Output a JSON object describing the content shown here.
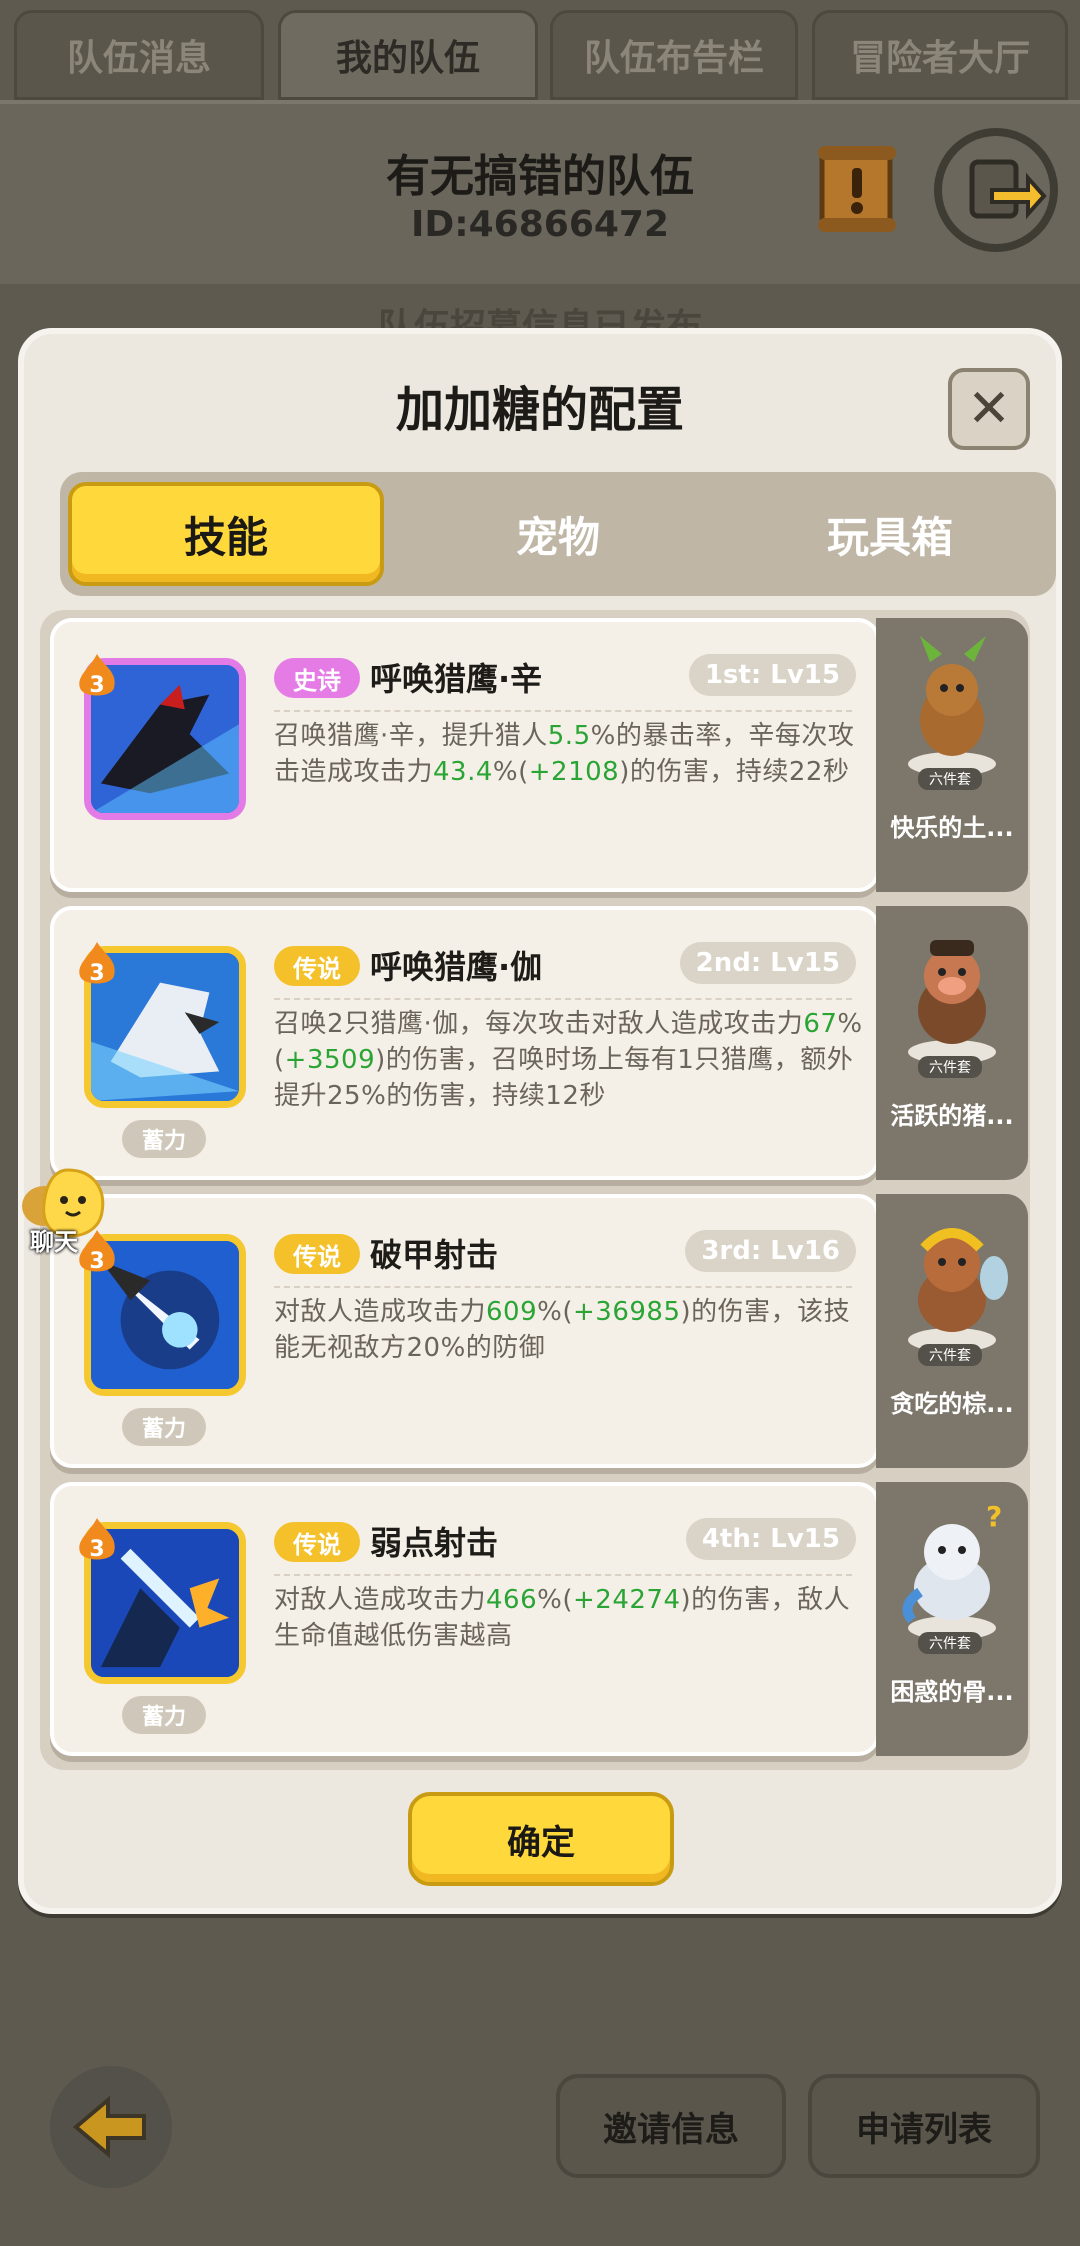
{
  "top_tabs": [
    {
      "label": "队伍消息"
    },
    {
      "label": "我的队伍"
    },
    {
      "label": "队伍布告栏"
    },
    {
      "label": "冒险者大厅"
    }
  ],
  "team": {
    "name": "有无搞错的队伍",
    "id": "ID:46866472",
    "ghost_text": "队伍招募信息已发布"
  },
  "modal": {
    "title": "加加糖的配置",
    "tabs": [
      {
        "label": "技能"
      },
      {
        "label": "宠物"
      },
      {
        "label": "玩具箱"
      }
    ],
    "confirm_label": "确定"
  },
  "skills": [
    {
      "rarity": "史诗",
      "name": "呼唤猎鹰·辛",
      "slot": "1st: Lv15",
      "level": "3",
      "charge": "",
      "desc_parts": [
        "召唤猎鹰·辛，提升猎人",
        "5.5",
        "%的暴击率，辛每次攻击造成攻击力",
        "43.4",
        "%(",
        "+2108",
        ")的伤害，持续22秒"
      ]
    },
    {
      "rarity": "传说",
      "name": "呼唤猎鹰·伽",
      "slot": "2nd: Lv15",
      "level": "3",
      "charge": "蓄力",
      "desc_parts": [
        "召唤2只猎鹰·伽，每次攻击对敌人造成攻击力",
        "67",
        "%(",
        "+3509",
        ")的伤害，召唤时场上每有1只猎鹰，额外提升25%的伤害，持续12秒"
      ]
    },
    {
      "rarity": "传说",
      "name": "破甲射击",
      "slot": "3rd: Lv16",
      "level": "3",
      "charge": "蓄力",
      "desc_parts": [
        "对敌人造成攻击力",
        "609",
        "%(",
        "+36985",
        ")的伤害，该技能无视敌方20%的防御"
      ]
    },
    {
      "rarity": "传说",
      "name": "弱点射击",
      "slot": "4th: Lv15",
      "level": "3",
      "charge": "蓄力",
      "desc_parts": [
        "对敌人造成攻击力",
        "466",
        "%(",
        "+24274",
        ")的伤害，敌人生命值越低伤害越高"
      ]
    }
  ],
  "pets": [
    {
      "name": "快乐的土...",
      "badge": "六件套"
    },
    {
      "name": "活跃的猪...",
      "badge": "六件套"
    },
    {
      "name": "贪吃的棕...",
      "badge": "六件套"
    },
    {
      "name": "困惑的骨...",
      "badge": "六件套"
    }
  ],
  "chat_label": "聊天",
  "bottom": {
    "invite_label": "邀请信息",
    "apply_label": "申请列表"
  },
  "colors": {
    "accent_yellow": "#ffd93b",
    "epic": "#e57ce6",
    "legend": "#f4c12a",
    "green_value": "#2aa535"
  }
}
